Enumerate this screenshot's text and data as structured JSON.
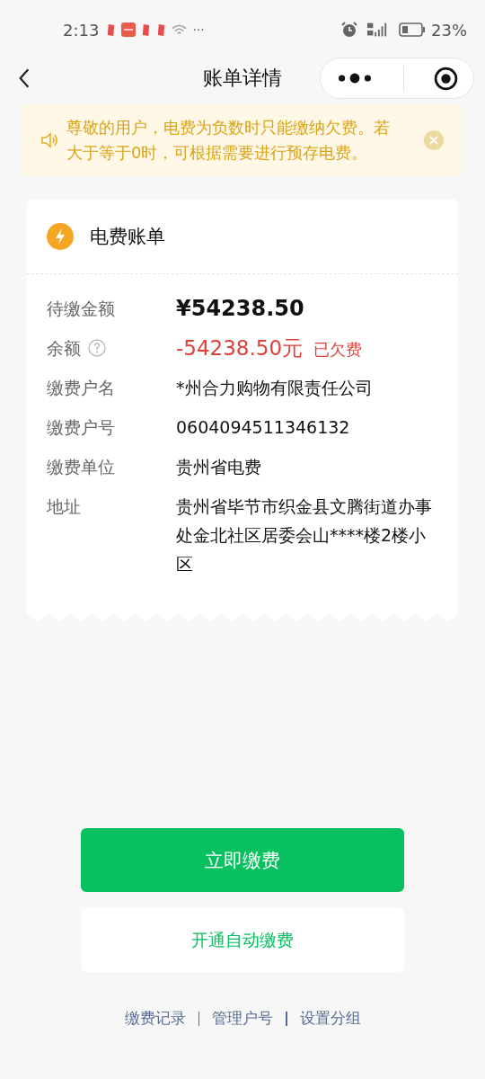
{
  "status_bar": {
    "time": "2:13",
    "more": "···",
    "battery_text": "23%"
  },
  "nav": {
    "title": "账单详情"
  },
  "notice": {
    "text": "尊敬的用户，电费为负数时只能缴纳欠费。若大于等于0时，可根据需要进行预存电费。"
  },
  "bill": {
    "title": "电费账单",
    "rows": [
      {
        "kind": "amount",
        "label": "待缴金额",
        "value": "¥54238.50"
      },
      {
        "kind": "balance",
        "label": "余额",
        "value": "-54238.50元",
        "tag": "已欠费"
      },
      {
        "kind": "plain",
        "label": "缴费户名",
        "value": "*州合力购物有限责任公司"
      },
      {
        "kind": "plain",
        "label": "缴费户号",
        "value": "0604094511346132"
      },
      {
        "kind": "plain",
        "label": "缴费单位",
        "value": "贵州省电费"
      },
      {
        "kind": "plain",
        "label": "地址",
        "value": "贵州省毕节市织金县文腾街道办事处金北社区居委会山****楼2楼小区"
      }
    ]
  },
  "buttons": {
    "primary": "立即缴费",
    "secondary": "开通自动缴费"
  },
  "links": [
    "缴费记录",
    "管理户号",
    "设置分组"
  ]
}
